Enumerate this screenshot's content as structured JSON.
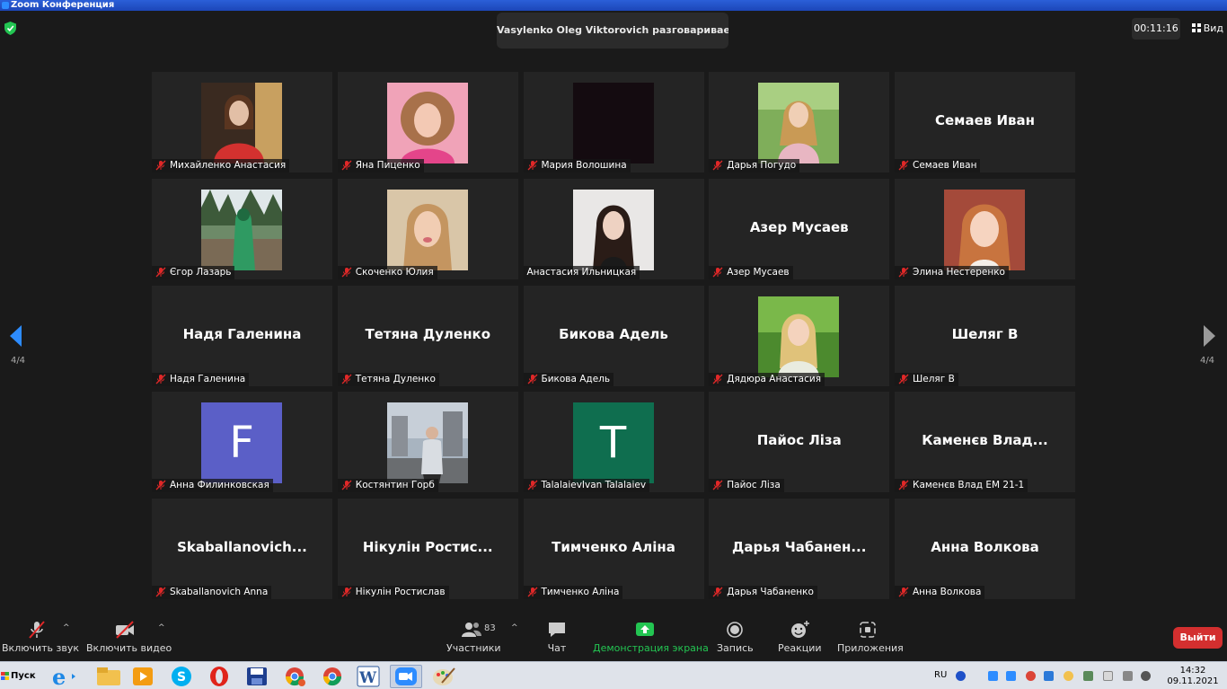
{
  "window": {
    "title": "Zoom Конференция"
  },
  "header": {
    "speaker_toast": "Vasylenko Oleg Viktorovich разговаривает…",
    "timer": "00:11:16",
    "view_label": "Вид"
  },
  "pagination": {
    "left": "4/4",
    "right": "4/4"
  },
  "participants": [
    {
      "name": "Михайленко Анастасия",
      "type": "photo",
      "photo": "red-top-woman"
    },
    {
      "name": "Яна Пиценко",
      "type": "photo",
      "photo": "pink-curly-hair"
    },
    {
      "name": "Мария Волошина",
      "type": "photo",
      "photo": "dark-video"
    },
    {
      "name": "Дарья Погудо",
      "type": "photo",
      "photo": "outdoor-blonde"
    },
    {
      "name": "Семаев Иван",
      "type": "name",
      "display": "Семаев Иван"
    },
    {
      "name": "Єгор Лазарь",
      "type": "photo",
      "photo": "green-forest"
    },
    {
      "name": "Скоченко Юлия",
      "type": "photo",
      "photo": "blonde-indoor"
    },
    {
      "name": "Анастасия Ильницкая",
      "type": "photo",
      "photo": "dark-hair-white",
      "muted": false
    },
    {
      "name": "Азер Мусаев",
      "type": "name",
      "display": "Азер Мусаев"
    },
    {
      "name": "Элина Нестеренко",
      "type": "photo",
      "photo": "redhead-light"
    },
    {
      "name": "Надя Галенина",
      "type": "name",
      "display": "Надя Галенина"
    },
    {
      "name": "Тетяна Дуленко",
      "type": "name",
      "display": "Тетяна Дуленко"
    },
    {
      "name": "Бикова Адель",
      "type": "name",
      "display": "Бикова Адель"
    },
    {
      "name": "Дядюра Анастасия",
      "type": "photo",
      "photo": "blonde-green"
    },
    {
      "name": "Шеляг В",
      "type": "name",
      "display": "Шеляг В"
    },
    {
      "name": "Анна Филинковская",
      "type": "letter",
      "letter": "F",
      "color": "#5b5fc7"
    },
    {
      "name": "Костянтин Горб",
      "type": "photo",
      "photo": "man-city"
    },
    {
      "name": "TalalaievIvan Talalaiev",
      "type": "letter",
      "letter": "T",
      "color": "#0f6e4f"
    },
    {
      "name": "Пайос Ліза",
      "type": "name",
      "display": "Пайос Ліза"
    },
    {
      "name": "Каменєв Влад ЕМ 21-1",
      "type": "name",
      "display": "Каменєв Влад..."
    },
    {
      "name": "Skaballanovich Anna",
      "type": "name",
      "display": "Skaballanovich..."
    },
    {
      "name": "Нікулін Ростислав",
      "type": "name",
      "display": "Нікулін Ростис..."
    },
    {
      "name": "Тимченко Аліна",
      "type": "name",
      "display": "Тимченко Аліна"
    },
    {
      "name": "Дарья Чабаненко",
      "type": "name",
      "display": "Дарья Чабанен..."
    },
    {
      "name": "Анна Волкова",
      "type": "name",
      "display": "Анна Волкова"
    }
  ],
  "toolbar": {
    "audio_label": "Включить звук",
    "video_label": "Включить видео",
    "participants_label": "Участники",
    "participants_count": "83",
    "chat_label": "Чат",
    "share_label": "Демонстрация экрана",
    "record_label": "Запись",
    "reactions_label": "Реакции",
    "apps_label": "Приложения",
    "leave_label": "Выйти",
    "share_color": "#23c552",
    "leave_color": "#d32f2f"
  },
  "taskbar": {
    "start_label": "Пуск",
    "language": "RU",
    "time": "14:32",
    "date": "09.11.2021"
  }
}
